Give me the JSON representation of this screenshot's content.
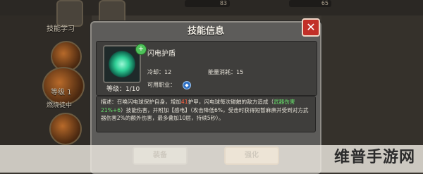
{
  "background": {
    "skill_learn_label": "技能学习",
    "level_label": "等级 1",
    "burning_label": "燃烧徒中",
    "resource_1": "83",
    "resource_2": "65"
  },
  "dialog": {
    "title": "技能信息",
    "close_label": "✕",
    "skill": {
      "name": "闪电护盾",
      "level_label": "等级：1/10",
      "cooldown_label": "冷却：",
      "cooldown_value": "12",
      "energy_label": "能量消耗：",
      "energy_value": "15",
      "class_label": "可用职业：",
      "upgrade_badge": "+"
    },
    "description": {
      "p1": "描述：召唤闪电球保护自身，增加",
      "shield_value": "41",
      "p2": "护甲，闪电球每次碰触的敌方造成（",
      "weapon_damage": "武器伤害21%+6",
      "p3": "）技能伤害，并附加【感电】（攻击降低6%，受击时获得短暂麻痹并受到对方武器伤害2%的额外伤害，最多叠加10层，持续5秒）。"
    },
    "buttons": {
      "equip": "装备",
      "upgrade": "强化"
    }
  },
  "watermark": "维普手游网",
  "colors": {
    "dialog_bg": "#5d5c5a",
    "close_red": "#c23028",
    "highlight_red": "#ff6040",
    "highlight_green": "#66e06a"
  }
}
